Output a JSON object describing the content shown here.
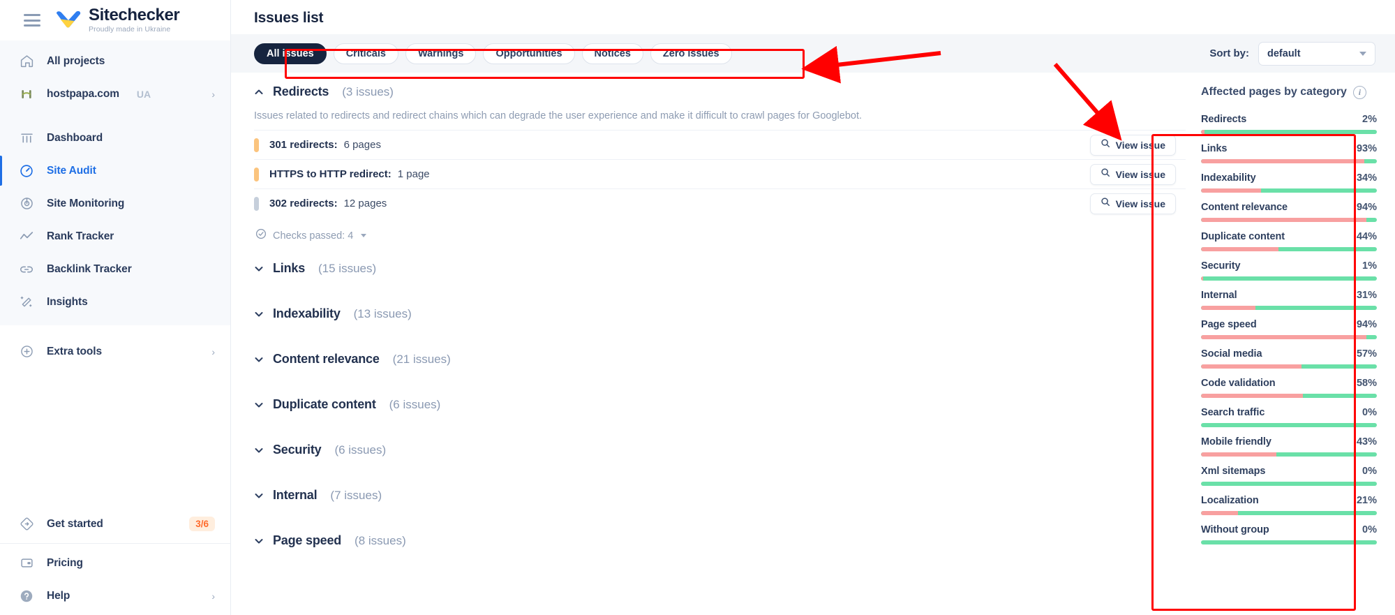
{
  "brand": {
    "name": "Sitechecker",
    "tagline": "Proudly made in Ukraine"
  },
  "sidebar": {
    "top_items": [
      {
        "label": "All projects",
        "icon": "home-icon"
      },
      {
        "label": "hostpapa.com",
        "suffix": "UA",
        "icon": "hostpapa-logo-icon",
        "chevron": "›"
      }
    ],
    "nav_items": [
      {
        "label": "Dashboard",
        "icon": "dashboard-icon",
        "active": false
      },
      {
        "label": "Site Audit",
        "icon": "site-audit-icon",
        "active": true
      },
      {
        "label": "Site Monitoring",
        "icon": "site-monitoring-icon",
        "active": false
      },
      {
        "label": "Rank Tracker",
        "icon": "rank-tracker-icon",
        "active": false
      },
      {
        "label": "Backlink Tracker",
        "icon": "backlink-tracker-icon",
        "active": false
      },
      {
        "label": "Insights",
        "icon": "insights-icon",
        "active": false
      }
    ],
    "extra": {
      "label": "Extra tools",
      "icon": "plus-circle-icon",
      "chevron": "›"
    },
    "get_started": {
      "label": "Get started",
      "icon": "get-started-icon",
      "badge": "3/6"
    },
    "bottom_items": [
      {
        "label": "Pricing",
        "icon": "pricing-icon"
      },
      {
        "label": "Help",
        "icon": "help-icon",
        "chevron": "›"
      }
    ]
  },
  "header": {
    "title": "Issues list"
  },
  "filters": {
    "chips": [
      {
        "label": "All issues",
        "active": true
      },
      {
        "label": "Criticals",
        "active": false
      },
      {
        "label": "Warnings",
        "active": false
      },
      {
        "label": "Opportunities",
        "active": false
      },
      {
        "label": "Notices",
        "active": false
      },
      {
        "label": "Zero issues",
        "active": false
      }
    ],
    "sort_label": "Sort by:",
    "sort_value": "default"
  },
  "groups": [
    {
      "name": "Redirects",
      "count": "(3 issues)",
      "expanded": true,
      "chevron": "up-chevron-icon",
      "description": "Issues related to redirects and redirect chains which can degrade the user experience and make it difficult to crawl pages for Googlebot.",
      "issues": [
        {
          "name": "301 redirects:",
          "pages": "6 pages",
          "severity": "warning",
          "action": "View issue"
        },
        {
          "name": "HTTPS to HTTP redirect:",
          "pages": "1 page",
          "severity": "warning",
          "action": "View issue"
        },
        {
          "name": "302 redirects:",
          "pages": "12 pages",
          "severity": "notice",
          "action": "View issue"
        }
      ],
      "checks_passed": "Checks passed: 4"
    },
    {
      "name": "Links",
      "count": "(15 issues)",
      "expanded": false,
      "chevron": "down-chevron-icon"
    },
    {
      "name": "Indexability",
      "count": "(13 issues)",
      "expanded": false,
      "chevron": "down-chevron-icon"
    },
    {
      "name": "Content relevance",
      "count": "(21 issues)",
      "expanded": false,
      "chevron": "down-chevron-icon"
    },
    {
      "name": "Duplicate content",
      "count": "(6 issues)",
      "expanded": false,
      "chevron": "down-chevron-icon"
    },
    {
      "name": "Security",
      "count": "(6 issues)",
      "expanded": false,
      "chevron": "down-chevron-icon"
    },
    {
      "name": "Internal",
      "count": "(7 issues)",
      "expanded": false,
      "chevron": "down-chevron-icon"
    },
    {
      "name": "Page speed",
      "count": "(8 issues)",
      "expanded": false,
      "chevron": "down-chevron-icon"
    }
  ],
  "affected": {
    "title": "Affected pages by category",
    "info_icon": "info-icon"
  },
  "chart_data": {
    "type": "bar",
    "title": "Affected pages by category",
    "orientation": "horizontal",
    "xlabel": "",
    "ylabel": "",
    "ylim": [
      0,
      100
    ],
    "unit": "%",
    "colors": {
      "affected": "#f8a0a0",
      "healthy": "#6ae0a8"
    },
    "categories": [
      "Redirects",
      "Links",
      "Indexability",
      "Content relevance",
      "Duplicate content",
      "Security",
      "Internal",
      "Page speed",
      "Social media",
      "Code validation",
      "Search traffic",
      "Mobile friendly",
      "Xml sitemaps",
      "Localization",
      "Without group"
    ],
    "values": [
      2,
      93,
      34,
      94,
      44,
      1,
      31,
      94,
      57,
      58,
      0,
      43,
      0,
      21,
      0
    ],
    "labels": [
      "2%",
      "93%",
      "34%",
      "94%",
      "44%",
      "1%",
      "31%",
      "94%",
      "57%",
      "58%",
      "0%",
      "43%",
      "0%",
      "21%",
      "0%"
    ]
  },
  "colors": {
    "accent": "#1f6fe5",
    "dark": "#16243f",
    "warning": "#fbc47e",
    "notice": "#c6cfdb",
    "bar_affected": "#f8a0a0",
    "bar_healthy": "#6ae0a8",
    "badge": "#ff6b2c",
    "annotation": "#ff0000"
  }
}
